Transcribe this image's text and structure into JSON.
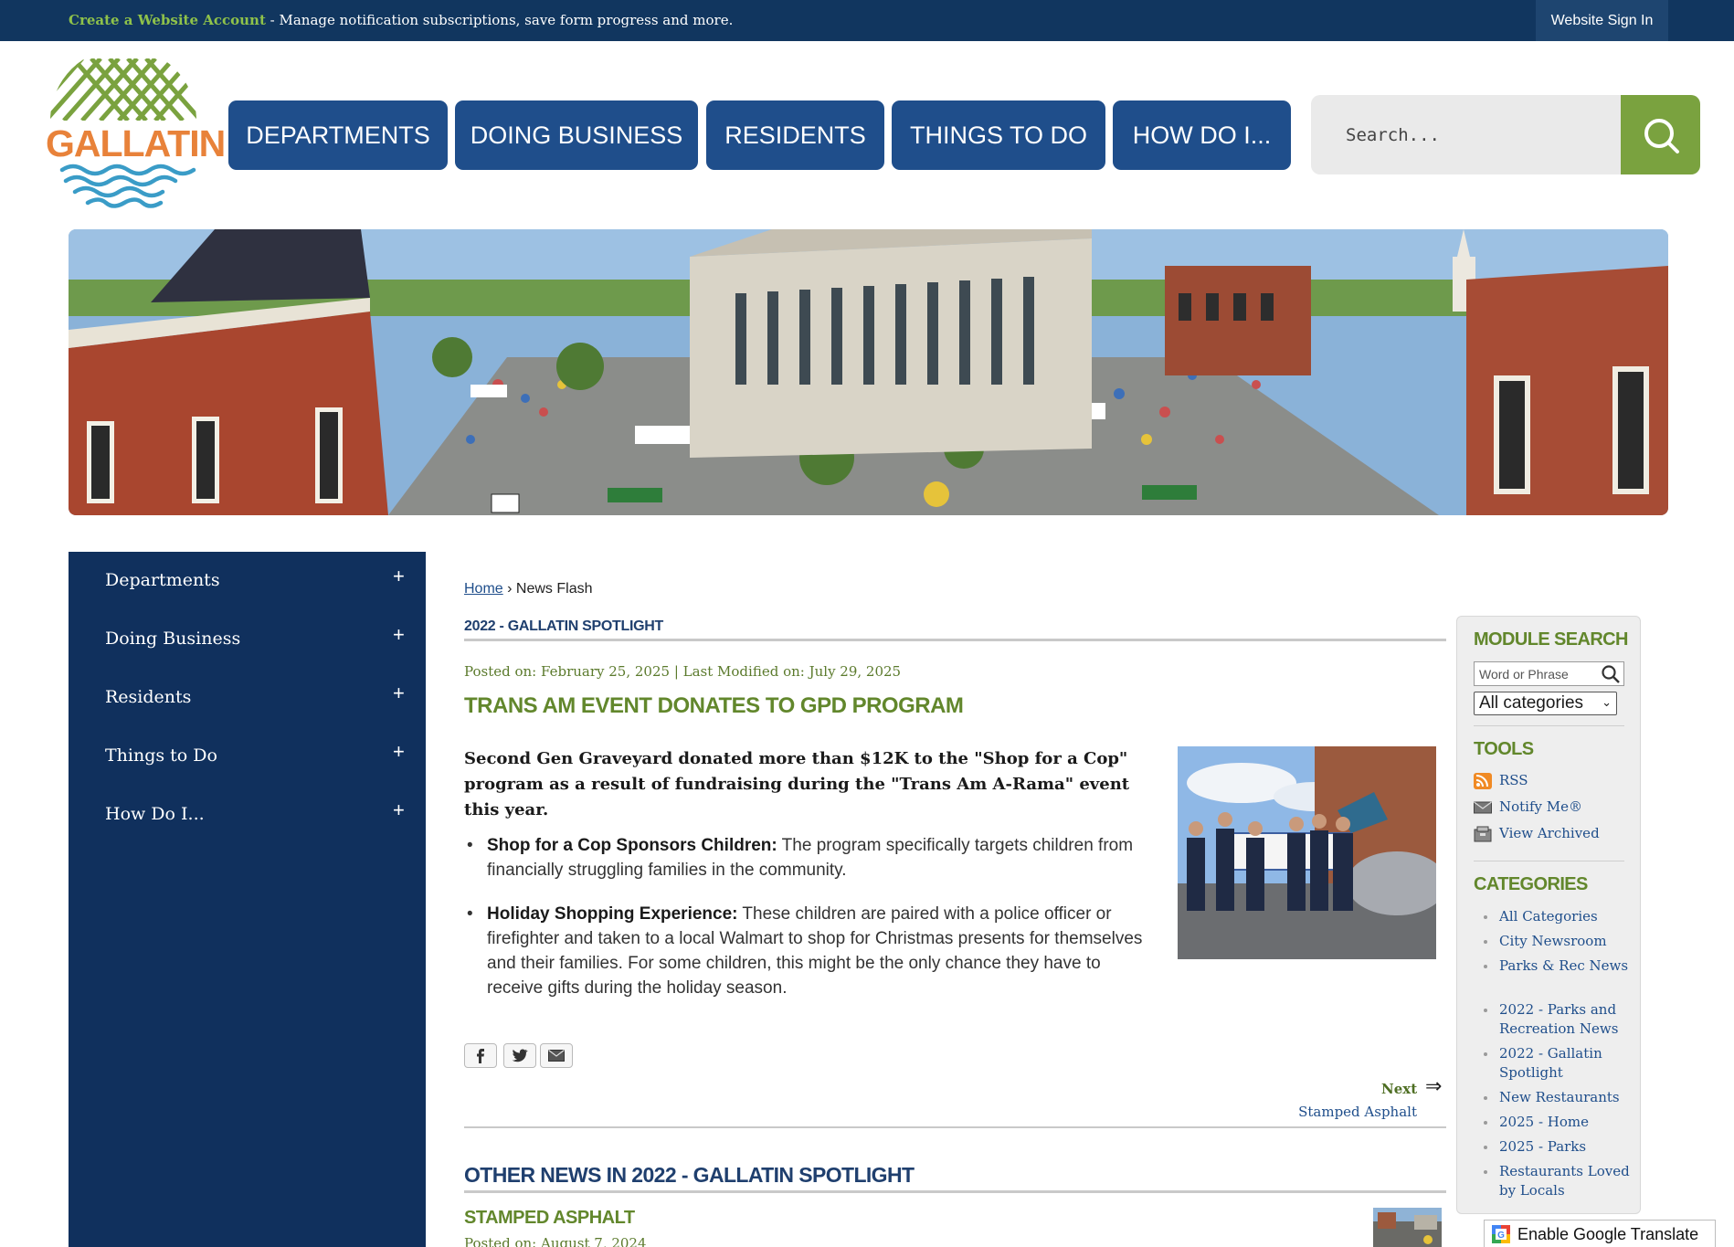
{
  "topbar": {
    "create_link": "Create a Website Account",
    "message": " - Manage notification subscriptions, save form progress and more.",
    "signin": "Website Sign In"
  },
  "logo": {
    "text": "GALLATIN"
  },
  "nav": {
    "items": [
      "DEPARTMENTS",
      "DOING BUSINESS",
      "RESIDENTS",
      "THINGS TO DO",
      "HOW DO I..."
    ]
  },
  "search": {
    "placeholder": "Search..."
  },
  "sidebar": {
    "items": [
      {
        "label": "Departments",
        "toggle": "+"
      },
      {
        "label": "Doing Business",
        "toggle": "+"
      },
      {
        "label": "Residents",
        "toggle": "+"
      },
      {
        "label": "Things to Do",
        "toggle": "+"
      },
      {
        "label": "How Do I...",
        "toggle": "+"
      }
    ]
  },
  "breadcrumb": {
    "home": "Home",
    "sep": " › ",
    "current": "News Flash"
  },
  "article": {
    "category": "2022 - GALLATIN SPOTLIGHT",
    "posted": "Posted on: February 25, 2025 | Last Modified on: July 29, 2025",
    "title": "TRANS AM EVENT DONATES TO GPD PROGRAM",
    "lede": "Second Gen Graveyard donated more than $12K to the \"Shop for a Cop\" program as a result of fundraising during the \"Trans Am A-Rama\" event this year.",
    "bullets": [
      {
        "bold": "Shop for a Cop Sponsors Children:",
        "text": " The program specifically targets children from financially struggling families in the community."
      },
      {
        "bold": "Holiday Shopping Experience:",
        "text": " These children are paired with a police officer or firefighter and taken to a local Walmart to shop for Christmas presents for themselves and their families. For some children, this might be the only chance they have to receive gifts during the holiday season."
      }
    ]
  },
  "share": {
    "icons": [
      "facebook-icon",
      "twitter-icon",
      "email-icon"
    ]
  },
  "next": {
    "label": "Next",
    "arrow": "⇒",
    "title": "Stamped Asphalt"
  },
  "other_news": {
    "heading": "OTHER NEWS IN 2022 - GALLATIN SPOTLIGHT",
    "first_title": "STAMPED ASPHALT",
    "first_posted": "Posted on: August 7, 2024"
  },
  "module": {
    "search_heading": "MODULE SEARCH",
    "search_placeholder": "Word or Phrase",
    "select_value": "All categories",
    "tools_heading": "TOOLS",
    "tools": [
      "RSS",
      "Notify Me®",
      "View Archived"
    ],
    "categories_heading": "CATEGORIES",
    "categories": [
      "All Categories",
      "City Newsroom",
      "Parks & Rec News",
      "2022 - Parks and Recreation News",
      "2022 - Gallatin Spotlight",
      "New Restaurants",
      "2025 - Home",
      "2025 - Parks",
      "Restaurants Loved by Locals"
    ]
  },
  "translate": {
    "label": "Enable Google Translate"
  },
  "colors": {
    "navy": "#11365f",
    "nav_button": "#1f4e8b",
    "sidebar": "#10305d",
    "green": "#62872c",
    "search_button": "#7aa23f",
    "logo_orange": "#e8823a"
  }
}
